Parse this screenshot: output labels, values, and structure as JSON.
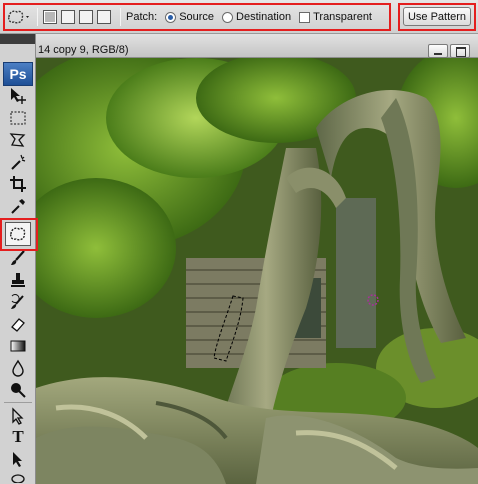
{
  "options_bar": {
    "patch_label": "Patch:",
    "source_label": "Source",
    "destination_label": "Destination",
    "transparent_label": "Transparent",
    "use_pattern_label": "Use Pattern",
    "patch_mode": "Source",
    "transparent_checked": false
  },
  "document": {
    "title_fragment": "14 copy 9, RGB/8)"
  },
  "toolbox": {
    "logo": "Ps",
    "type_tool_glyph": "T"
  },
  "colors": {
    "highlight": "#e41e1e",
    "foliage": "#4f7a1e",
    "bark": "#8a8f6a"
  }
}
